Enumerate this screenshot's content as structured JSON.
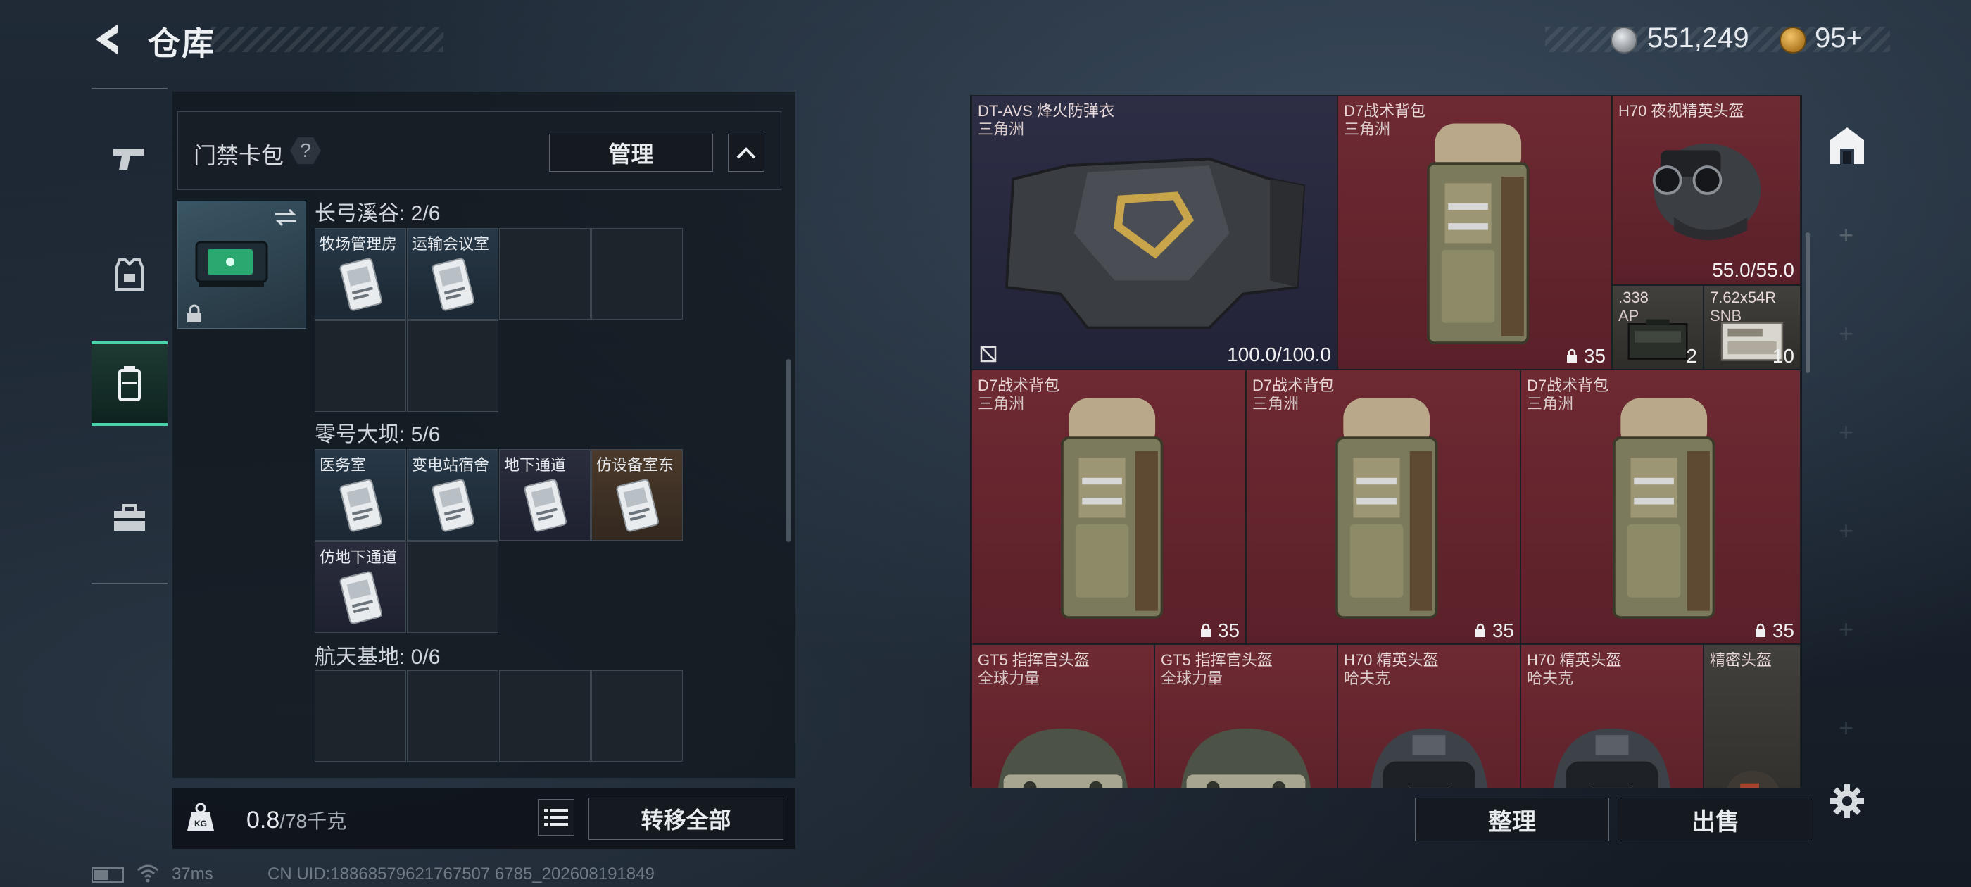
{
  "header": {
    "title": "仓库",
    "currencies": [
      {
        "name": "silver-coin-icon",
        "value": "551,249"
      },
      {
        "name": "gold-coin-icon",
        "value": "95+"
      }
    ]
  },
  "category_rail": {
    "items": [
      {
        "icon": "pistol-icon",
        "active": false
      },
      {
        "icon": "armor-vest-icon",
        "active": false
      },
      {
        "icon": "backpack-icon",
        "active": true
      },
      {
        "icon": "toolbox-icon",
        "active": false
      }
    ]
  },
  "card_pack": {
    "title": "门禁卡包",
    "help": "?",
    "manage_label": "管理",
    "sections": [
      {
        "label": "长弓溪谷: 2/6",
        "slots": [
          {
            "name": "牧场管理房",
            "filled": true,
            "tone": "filled"
          },
          {
            "name": "运输会议室",
            "filled": true,
            "tone": "filled"
          },
          {
            "name": "",
            "filled": false
          },
          {
            "name": "",
            "filled": false
          },
          {
            "name": "",
            "filled": false
          },
          {
            "name": "",
            "filled": false
          }
        ]
      },
      {
        "label": "零号大坝: 5/6",
        "slots": [
          {
            "name": "医务室",
            "filled": true,
            "tone": "filled"
          },
          {
            "name": "变电站宿舍",
            "filled": true,
            "tone": "filled"
          },
          {
            "name": "地下通道",
            "filled": true,
            "tone": "dark"
          },
          {
            "name": "仿设备室东",
            "filled": true,
            "tone": "brown"
          },
          {
            "name": "仿地下通道",
            "filled": true,
            "tone": "dark"
          },
          {
            "name": "",
            "filled": false
          }
        ]
      },
      {
        "label": "航天基地: 0/6",
        "slots": [
          {
            "name": "",
            "filled": false
          },
          {
            "name": "",
            "filled": false
          },
          {
            "name": "",
            "filled": false
          },
          {
            "name": "",
            "filled": false
          }
        ]
      }
    ]
  },
  "weight": {
    "current": "0.8",
    "max": "/78千克"
  },
  "transfer_all_label": "转移全部",
  "inventory": {
    "items": [
      {
        "n1": "DT-AVS 烽火防弹衣",
        "n2": "三角洲",
        "val": "100.0/100.0",
        "tone": "navy",
        "kind": "vest"
      },
      {
        "n1": "D7战术背包",
        "n2": "三角洲",
        "count": "35",
        "tone": "red",
        "kind": "pack"
      },
      {
        "n1": "H70 夜视精英头盔",
        "n2": "",
        "val": "55.0/55.0",
        "tone": "red",
        "kind": "nvg"
      },
      {
        "n1": ".338",
        "n2": "AP",
        "count": "2",
        "tone": "grey",
        "kind": "ammo"
      },
      {
        "n1": "7.62x54R",
        "n2": "SNB",
        "count": "10",
        "tone": "grey",
        "kind": "ammo2"
      },
      {
        "n1": "D7战术背包",
        "n2": "三角洲",
        "count": "35",
        "tone": "red",
        "kind": "pack"
      },
      {
        "n1": "D7战术背包",
        "n2": "三角洲",
        "count": "35",
        "tone": "red",
        "kind": "pack"
      },
      {
        "n1": "D7战术背包",
        "n2": "三角洲",
        "count": "35",
        "tone": "red",
        "kind": "pack"
      },
      {
        "n1": "GT5 指挥官头盔",
        "n2": "全球力量",
        "tone": "red",
        "kind": "helmet-g"
      },
      {
        "n1": "GT5 指挥官头盔",
        "n2": "全球力量",
        "tone": "red",
        "kind": "helmet-g"
      },
      {
        "n1": "H70 精英头盔",
        "n2": "哈夫克",
        "tone": "red",
        "kind": "helmet-b"
      },
      {
        "n1": "H70 精英头盔",
        "n2": "哈夫克",
        "tone": "red",
        "kind": "helmet-b"
      },
      {
        "n1": "精密头盔",
        "n2": "",
        "tone": "grey",
        "kind": "helmet-s"
      }
    ]
  },
  "sort_label": "整理",
  "sell_label": "出售",
  "status": {
    "ping": "37ms",
    "uid": "CN UID:18868579621767507 6785_202608191849"
  }
}
